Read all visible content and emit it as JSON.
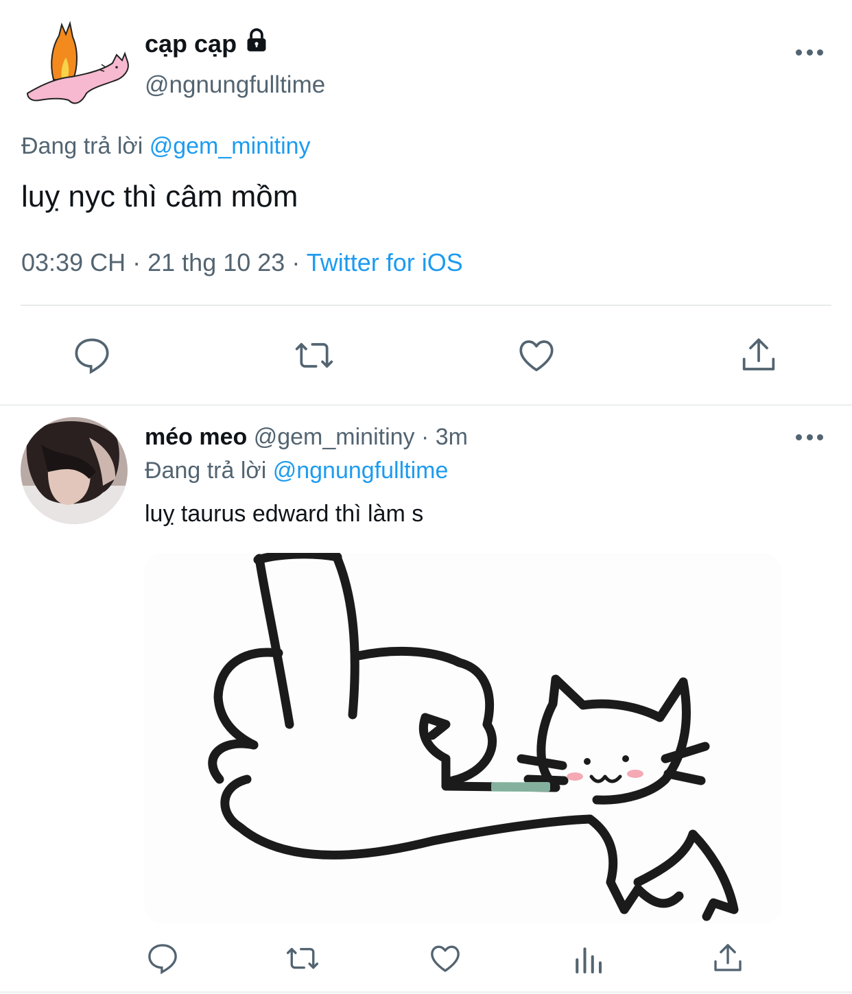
{
  "main_tweet": {
    "display_name": "cạp cạp",
    "handle": "@ngnungfulltime",
    "replying_prefix": "Đang trả lời",
    "replying_to": "@gem_minitiny",
    "text": "luỵ nyc thì câm mồm",
    "time": "03:39 CH",
    "separator": "·",
    "date": "21 thg 10 23",
    "source": "Twitter for iOS",
    "icons": {
      "protected": "lock-icon",
      "more": "more-icon",
      "actions": [
        "reply-icon",
        "retweet-icon",
        "like-icon",
        "share-icon"
      ]
    }
  },
  "reply_tweet": {
    "display_name": "méo meo",
    "handle": "@gem_minitiny",
    "separator": "·",
    "time_ago": "3m",
    "replying_prefix": "Đang trả lời",
    "replying_to": "@ngnungfulltime",
    "text": "luỵ taurus edward thì làm s",
    "icons": {
      "more": "more-icon",
      "actions": [
        "reply-icon",
        "retweet-icon",
        "like-icon",
        "analytics-icon",
        "share-icon"
      ]
    }
  },
  "colors": {
    "accent": "#1d9bf0",
    "secondary_text": "#536471",
    "primary_text": "#0f1419",
    "divider": "#e7e9ea"
  }
}
